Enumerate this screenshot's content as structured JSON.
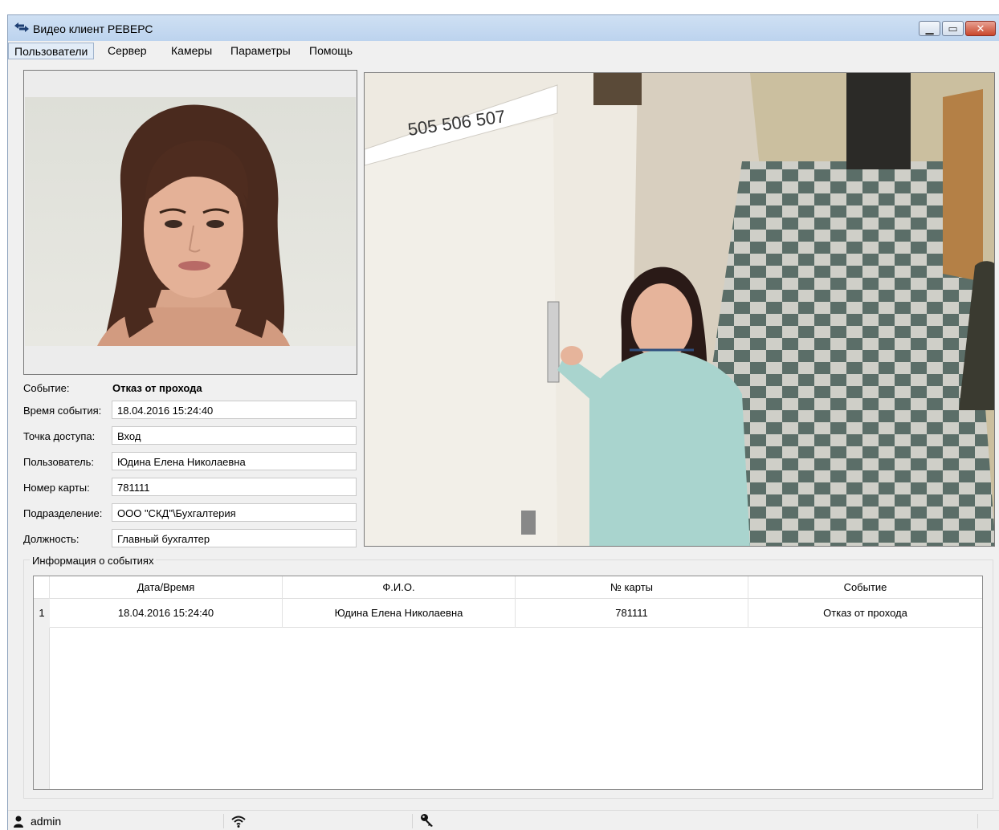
{
  "window": {
    "title": "Видео клиент РЕВЕРС",
    "controls": {
      "minimize_icon": "minimize-icon",
      "maximize_icon": "maximize-icon",
      "close_icon": "close-icon"
    }
  },
  "menu": {
    "items": [
      {
        "label": "Пользователи",
        "active": true
      },
      {
        "label": "Сервер",
        "active": false
      },
      {
        "label": "Камеры",
        "active": false
      },
      {
        "label": "Параметры",
        "active": false
      },
      {
        "label": "Помощь",
        "active": false
      }
    ]
  },
  "event": {
    "event_label": "Событие:",
    "event_value": "Отказ от прохода",
    "time_label": "Время события:",
    "time_value": "18.04.2016 15:24:40",
    "access_point_label": "Точка доступа:",
    "access_point_value": "Вход",
    "user_label": "Пользователь:",
    "user_value": "Юдина Елена Николаевна",
    "card_label": "Номер карты:",
    "card_value": "781111",
    "department_label": "Подразделение:",
    "department_value": "ООО \"СКД\"\\Бухгалтерия",
    "position_label": "Должность:",
    "position_value": "Главный бухгалтер"
  },
  "camera": {
    "door_numbers": "505  506  507"
  },
  "events_table": {
    "group_title": "Информация о событиях",
    "columns": [
      "Дата/Время",
      "Ф.И.О.",
      "№ карты",
      "Событие"
    ],
    "rows": [
      {
        "num": "1",
        "datetime": "18.04.2016 15:24:40",
        "name": "Юдина Елена Николаевна",
        "card": "781111",
        "event": "Отказ от прохода"
      }
    ]
  },
  "status": {
    "user": "admin",
    "icons": [
      "user-icon",
      "wifi-icon",
      "key-icon"
    ]
  },
  "colors": {
    "titlebar": "#c4d8f0",
    "window_bg": "#f0f0f0",
    "close_button": "#c9462b"
  }
}
